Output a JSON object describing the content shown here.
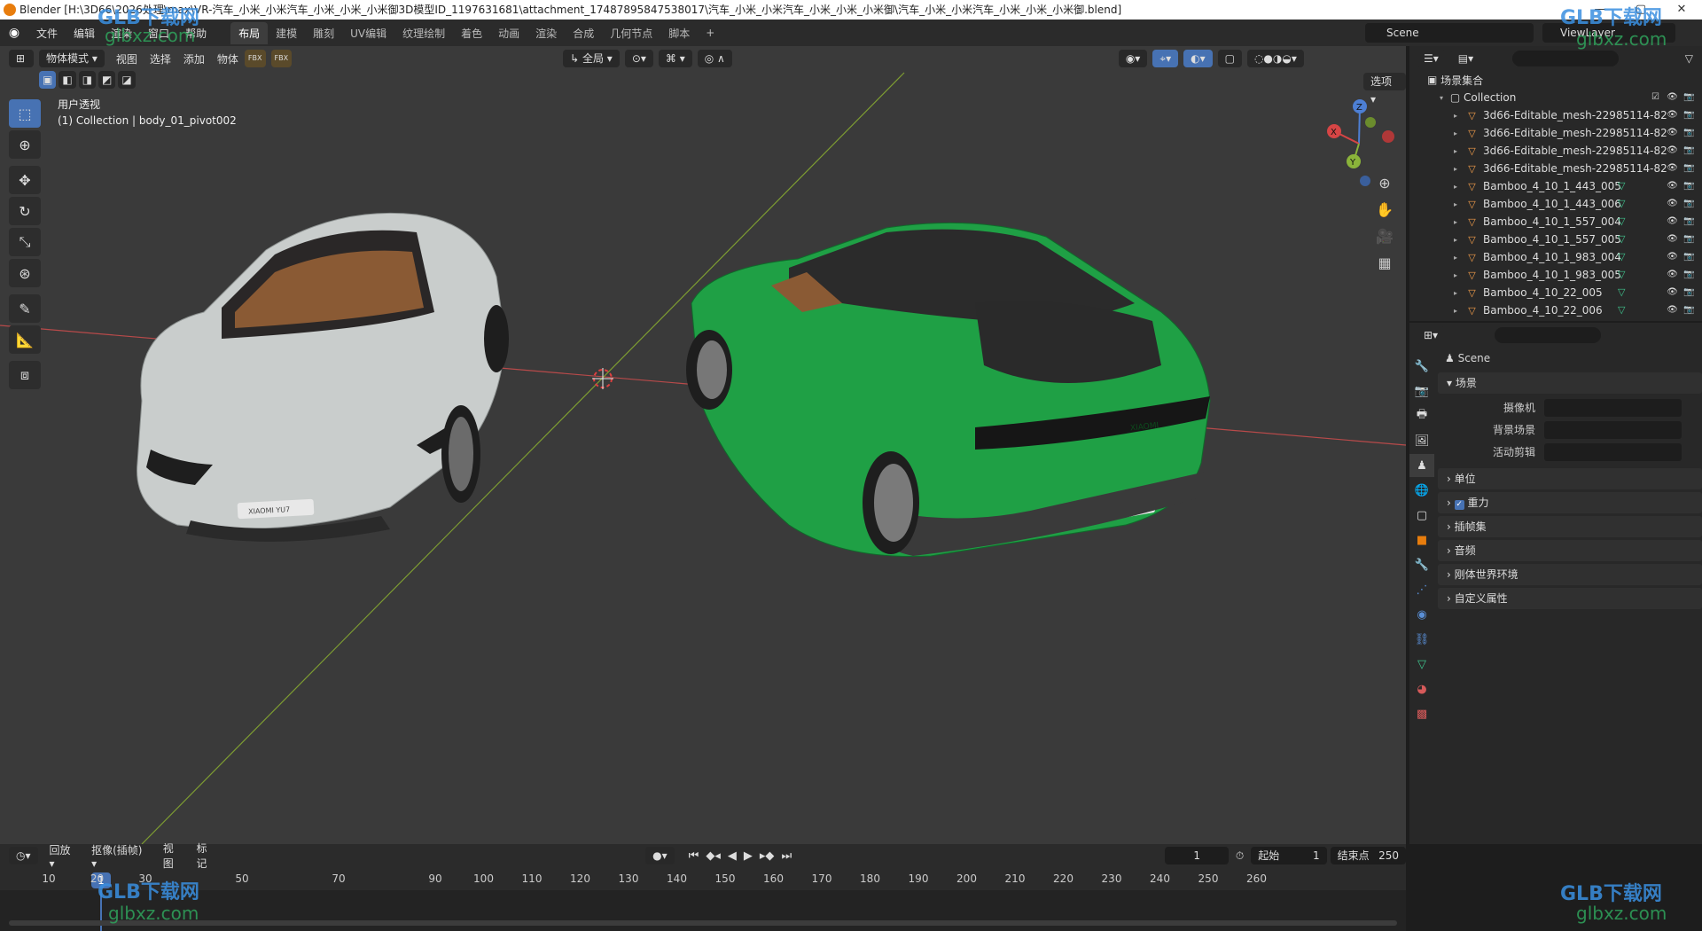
{
  "window": {
    "title": "Blender [H:\\3D66\\2026处理\\max\\VR-汽车_小米_小米汽车_小米_小米_小米御3D模型ID_1197631681\\attachment_17487895847538017\\汽车_小米_小米汽车_小米_小米_小米御\\汽车_小米_小米汽车_小米_小米_小米御.blend]",
    "minimize": "—",
    "maximize": "▢",
    "close": "✕"
  },
  "menubar": {
    "menus": [
      "文件",
      "编辑",
      "渲染",
      "窗口",
      "帮助"
    ],
    "workspaces": [
      "布局",
      "建模",
      "雕刻",
      "UV编辑",
      "纹理绘制",
      "着色",
      "动画",
      "渲染",
      "合成",
      "几何节点",
      "脚本"
    ],
    "add_tab": "+",
    "scene": "Scene",
    "view_layer": "ViewLayer"
  },
  "viewport": {
    "mode": "物体模式",
    "menus": [
      "视图",
      "选择",
      "添加",
      "物体"
    ],
    "transform_orientation": "全局",
    "options": "选项",
    "view_name": "用户透视",
    "active_info": "(1) Collection | body_01_pivot002",
    "gizmo": {
      "x": "X",
      "y": "Y",
      "z": "Z"
    },
    "fbx_label": "FBX",
    "car_badge": "XIAOMI YU7",
    "car_rear_badge": "XIAOMI"
  },
  "tools": [
    "select-box-icon",
    "cursor-icon",
    "move-icon",
    "rotate-icon",
    "scale-icon",
    "transform-icon",
    "annotate-icon",
    "measure-icon",
    "add-cube-icon"
  ],
  "outliner": {
    "root": "场景集合",
    "collection": "Collection",
    "items": [
      {
        "name": "3d66-Editable_mesh-22985114-82",
        "has_vertex": false
      },
      {
        "name": "3d66-Editable_mesh-22985114-82",
        "has_vertex": false
      },
      {
        "name": "3d66-Editable_mesh-22985114-82",
        "has_vertex": false
      },
      {
        "name": "3d66-Editable_mesh-22985114-82",
        "has_vertex": false
      },
      {
        "name": "Bamboo_4_10_1_443_005",
        "has_vertex": true
      },
      {
        "name": "Bamboo_4_10_1_443_006",
        "has_vertex": true
      },
      {
        "name": "Bamboo_4_10_1_557_004",
        "has_vertex": true
      },
      {
        "name": "Bamboo_4_10_1_557_005",
        "has_vertex": true
      },
      {
        "name": "Bamboo_4_10_1_983_004",
        "has_vertex": true
      },
      {
        "name": "Bamboo_4_10_1_983_005",
        "has_vertex": true
      },
      {
        "name": "Bamboo_4_10_22_005",
        "has_vertex": true
      },
      {
        "name": "Bamboo_4_10_22_006",
        "has_vertex": true
      }
    ]
  },
  "properties": {
    "context": "Scene",
    "section": "场景",
    "fields": [
      {
        "label": "摄像机"
      },
      {
        "label": "背景场景"
      },
      {
        "label": "活动剪辑"
      }
    ],
    "panels": [
      "单位",
      "重力",
      "插帧集",
      "音频",
      "刚体世界环境",
      "自定义属性"
    ],
    "gravity_checked": true
  },
  "timeline": {
    "menus": [
      "回放",
      "抠像(插帧)",
      "视图",
      "标记"
    ],
    "current_frame": "1",
    "start_label": "起始",
    "start": "1",
    "end_label": "结束点",
    "end": "250",
    "ruler": [
      "10",
      "20",
      "30",
      "50",
      "70",
      "90",
      "100",
      "110",
      "120",
      "130",
      "140",
      "150",
      "160",
      "170",
      "180",
      "190",
      "200",
      "210",
      "220",
      "230",
      "240",
      "250",
      "260"
    ],
    "ruler_frames": [
      10,
      20,
      30,
      50,
      70,
      90,
      100,
      110,
      120,
      130,
      140,
      150,
      160,
      170,
      180,
      190,
      200,
      210,
      220,
      230,
      240,
      250,
      260
    ]
  },
  "watermark": {
    "brand": "GLB下载网",
    "site": "glbxz.com"
  },
  "colors": {
    "accent": "#4772b3",
    "viewport_bg": "#3a3a3a",
    "panel_bg": "#282828",
    "car_green": "#1fa045",
    "car_white": "#c9cdcc",
    "axis_x": "#d64545",
    "axis_y": "#8ab33a",
    "mesh_icon": "#f29d4a"
  }
}
